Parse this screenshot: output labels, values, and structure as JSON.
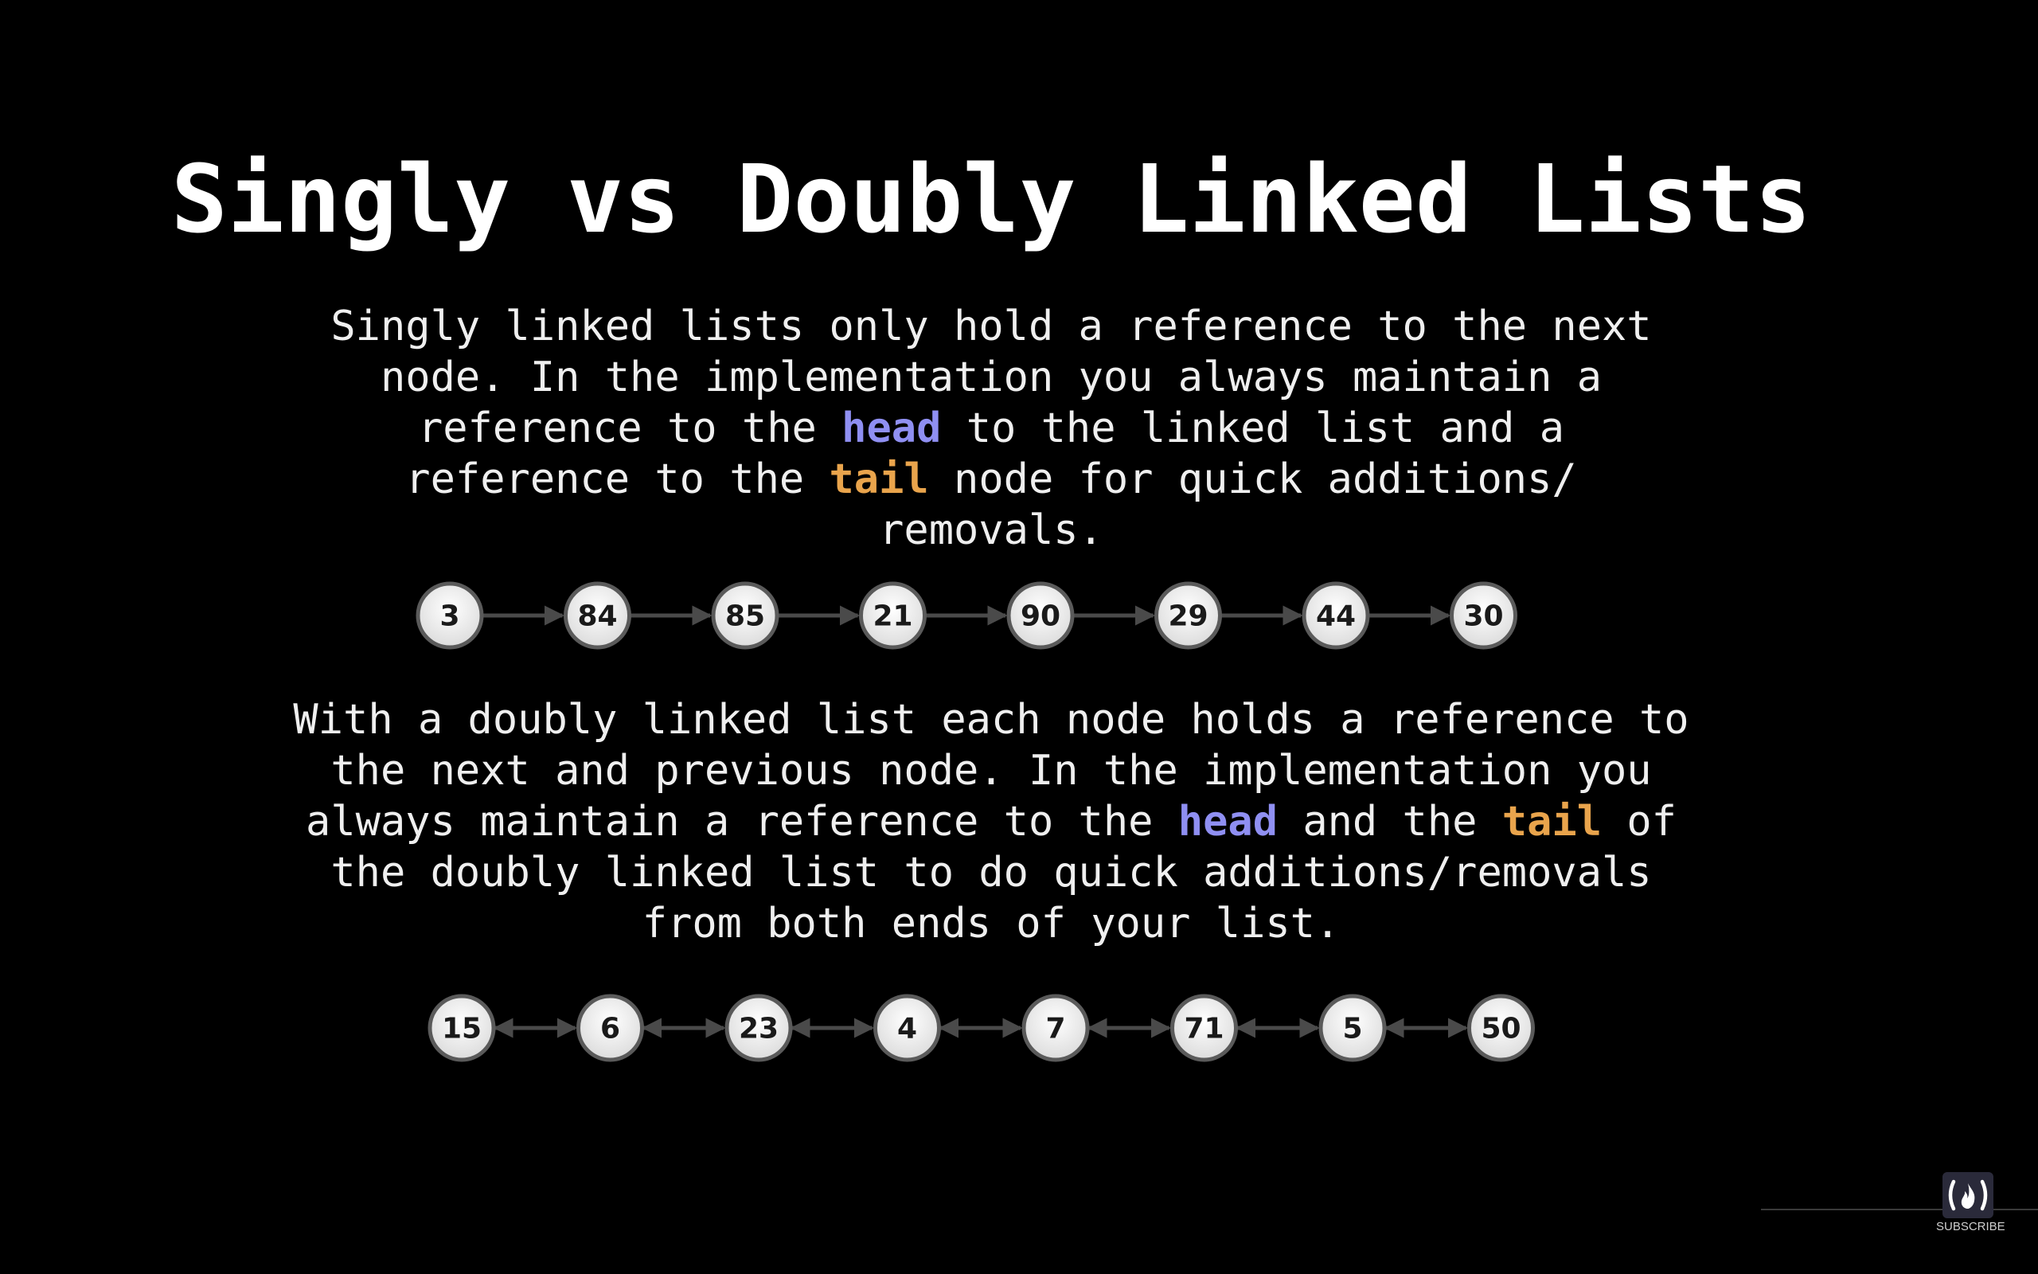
{
  "slide": {
    "title": "Singly vs Doubly Linked Lists",
    "singly": {
      "lines": [
        [
          {
            "t": "Singly linked lists only hold a reference to the next"
          }
        ],
        [
          {
            "t": "node. In the implementation you always maintain a"
          }
        ],
        [
          {
            "t": "reference to the "
          },
          {
            "t": "head",
            "hl": "head"
          },
          {
            "t": " to the linked list and a"
          }
        ],
        [
          {
            "t": "reference to the "
          },
          {
            "t": "tail",
            "hl": "tail"
          },
          {
            "t": " node for quick additions/"
          }
        ],
        [
          {
            "t": "removals."
          }
        ]
      ],
      "nodes": [
        "3",
        "84",
        "85",
        "21",
        "90",
        "29",
        "44",
        "30"
      ]
    },
    "doubly": {
      "lines": [
        [
          {
            "t": "With a doubly linked list each node holds a reference to"
          }
        ],
        [
          {
            "t": "the next and previous node. In the implementation you"
          }
        ],
        [
          {
            "t": "always maintain a reference to the "
          },
          {
            "t": "head",
            "hl": "head"
          },
          {
            "t": " and the "
          },
          {
            "t": "tail",
            "hl": "tail"
          },
          {
            "t": " of"
          }
        ],
        [
          {
            "t": "the doubly linked list to do quick additions/removals"
          }
        ],
        [
          {
            "t": "from both ends of your list."
          }
        ]
      ],
      "nodes": [
        "15",
        "6",
        "23",
        "4",
        "7",
        "71",
        "5",
        "50"
      ]
    }
  },
  "colors": {
    "background": "#000000",
    "head": "#8f8ff2",
    "tail": "#e9a44c",
    "node_fill": "#f2f2f2",
    "node_border": "#5a5a5a",
    "arrow": "#4a4a4a"
  },
  "overlay": {
    "subscribe_label": "SUBSCRIBE",
    "logo_icon": "freecodecamp-flame-icon"
  }
}
